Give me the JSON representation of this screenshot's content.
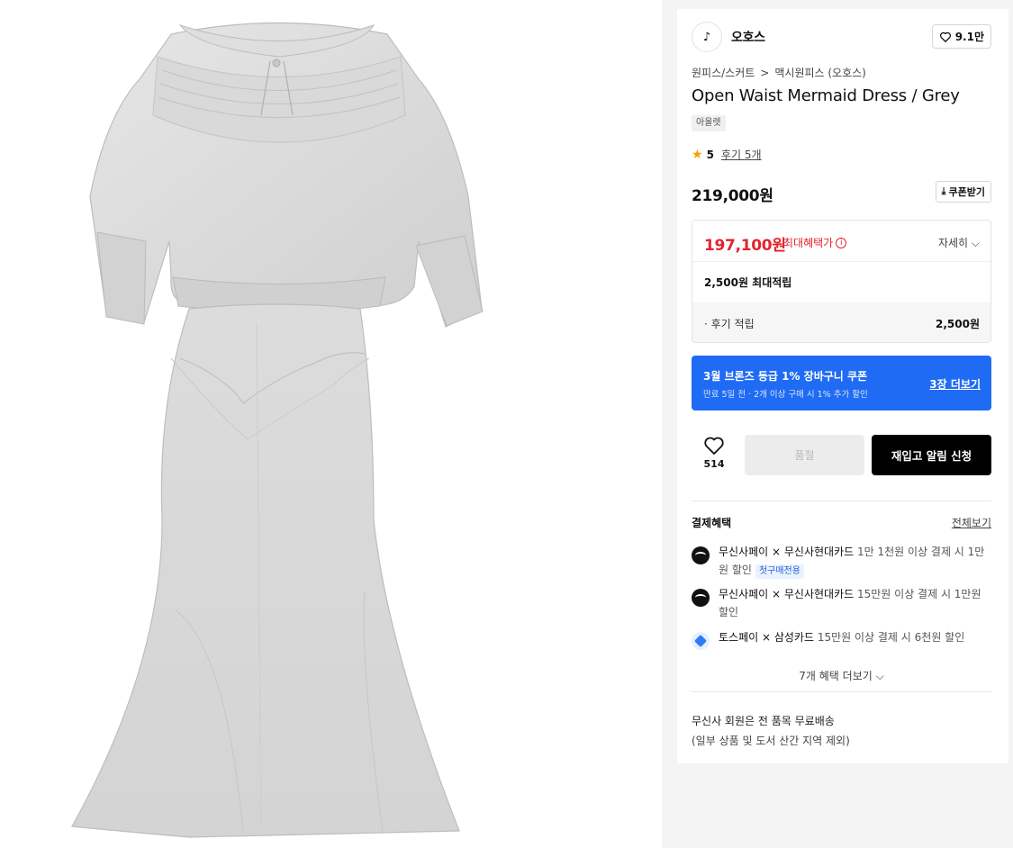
{
  "product_image": {
    "alt": "Open Waist Mermaid Dress Grey product photo"
  },
  "brand": {
    "logo_text": "♪",
    "name": "오호스",
    "likes": "9.1만"
  },
  "breadcrumb": {
    "category": "원피스/스커트",
    "separator": ">",
    "subcategory": "맥시원피스 (오호스)"
  },
  "product": {
    "name": "Open Waist Mermaid Dress / Grey",
    "tag": "아울렛"
  },
  "rating": {
    "score": "5",
    "reviews": "후기 5개"
  },
  "price": {
    "regular": "219,000원",
    "coupon_button": "쿠폰받기"
  },
  "benefit": {
    "max_price": "197,100원",
    "max_label": "최대혜택가",
    "detail": "자세히",
    "points_label": "2,500원 최대적립",
    "review_points_label": "· 후기 적립",
    "review_points_value": "2,500원"
  },
  "coupon_banner": {
    "title": "3월 브론즈 등급 1% 장바구니 쿠폰",
    "subtitle": "만료 5일 전 · 2개 이상 구매 시 1% 추가 할인",
    "more": "3장 더보기"
  },
  "actions": {
    "wish_count": "514",
    "soldout": "품절",
    "restock": "재입고 알림 신청"
  },
  "payment": {
    "title": "결제혜택",
    "view_all": "전체보기",
    "items": [
      {
        "bold": "무신사페이 × 무신사현대카드",
        "rest": " 1만 1천원 이상 결제 시 1만원 할인",
        "badge": "첫구매전용"
      },
      {
        "bold": "무신사페이 × 무신사현대카드",
        "rest": " 15만원 이상 결제 시 1만원 할인",
        "badge": ""
      },
      {
        "bold": "토스페이 × 삼성카드",
        "rest": " 15만원 이상 결제 시 6천원 할인",
        "badge": ""
      }
    ],
    "more": "7개 혜택 더보기"
  },
  "shipping": {
    "line1": "무신사 회원은 전 품목 무료배송",
    "line2": "(일부 상품 및 도서 산간 지역 제외)"
  },
  "colors": {
    "price_red": "#e3232e",
    "banner_blue": "#1f6bf3",
    "button_black": "#000000"
  }
}
